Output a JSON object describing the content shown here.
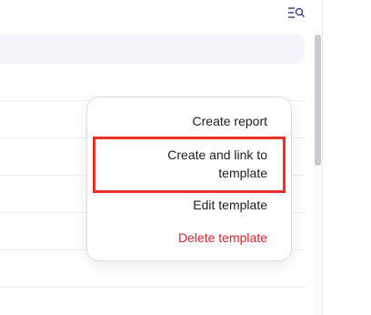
{
  "toolbar": {
    "filter_icon": "filter-list-search-icon"
  },
  "context_menu": {
    "items": [
      {
        "label": "Create report",
        "tone": "default"
      },
      {
        "label_line1": "Create and link to",
        "label_line2": "template",
        "tone": "default"
      },
      {
        "label": "Edit template",
        "tone": "default"
      },
      {
        "label": "Delete template",
        "tone": "danger"
      }
    ]
  },
  "colors": {
    "danger": "#e0212a",
    "highlight": "#e8312a",
    "text": "#1b1d22",
    "search_bg": "#f3f5fa"
  }
}
